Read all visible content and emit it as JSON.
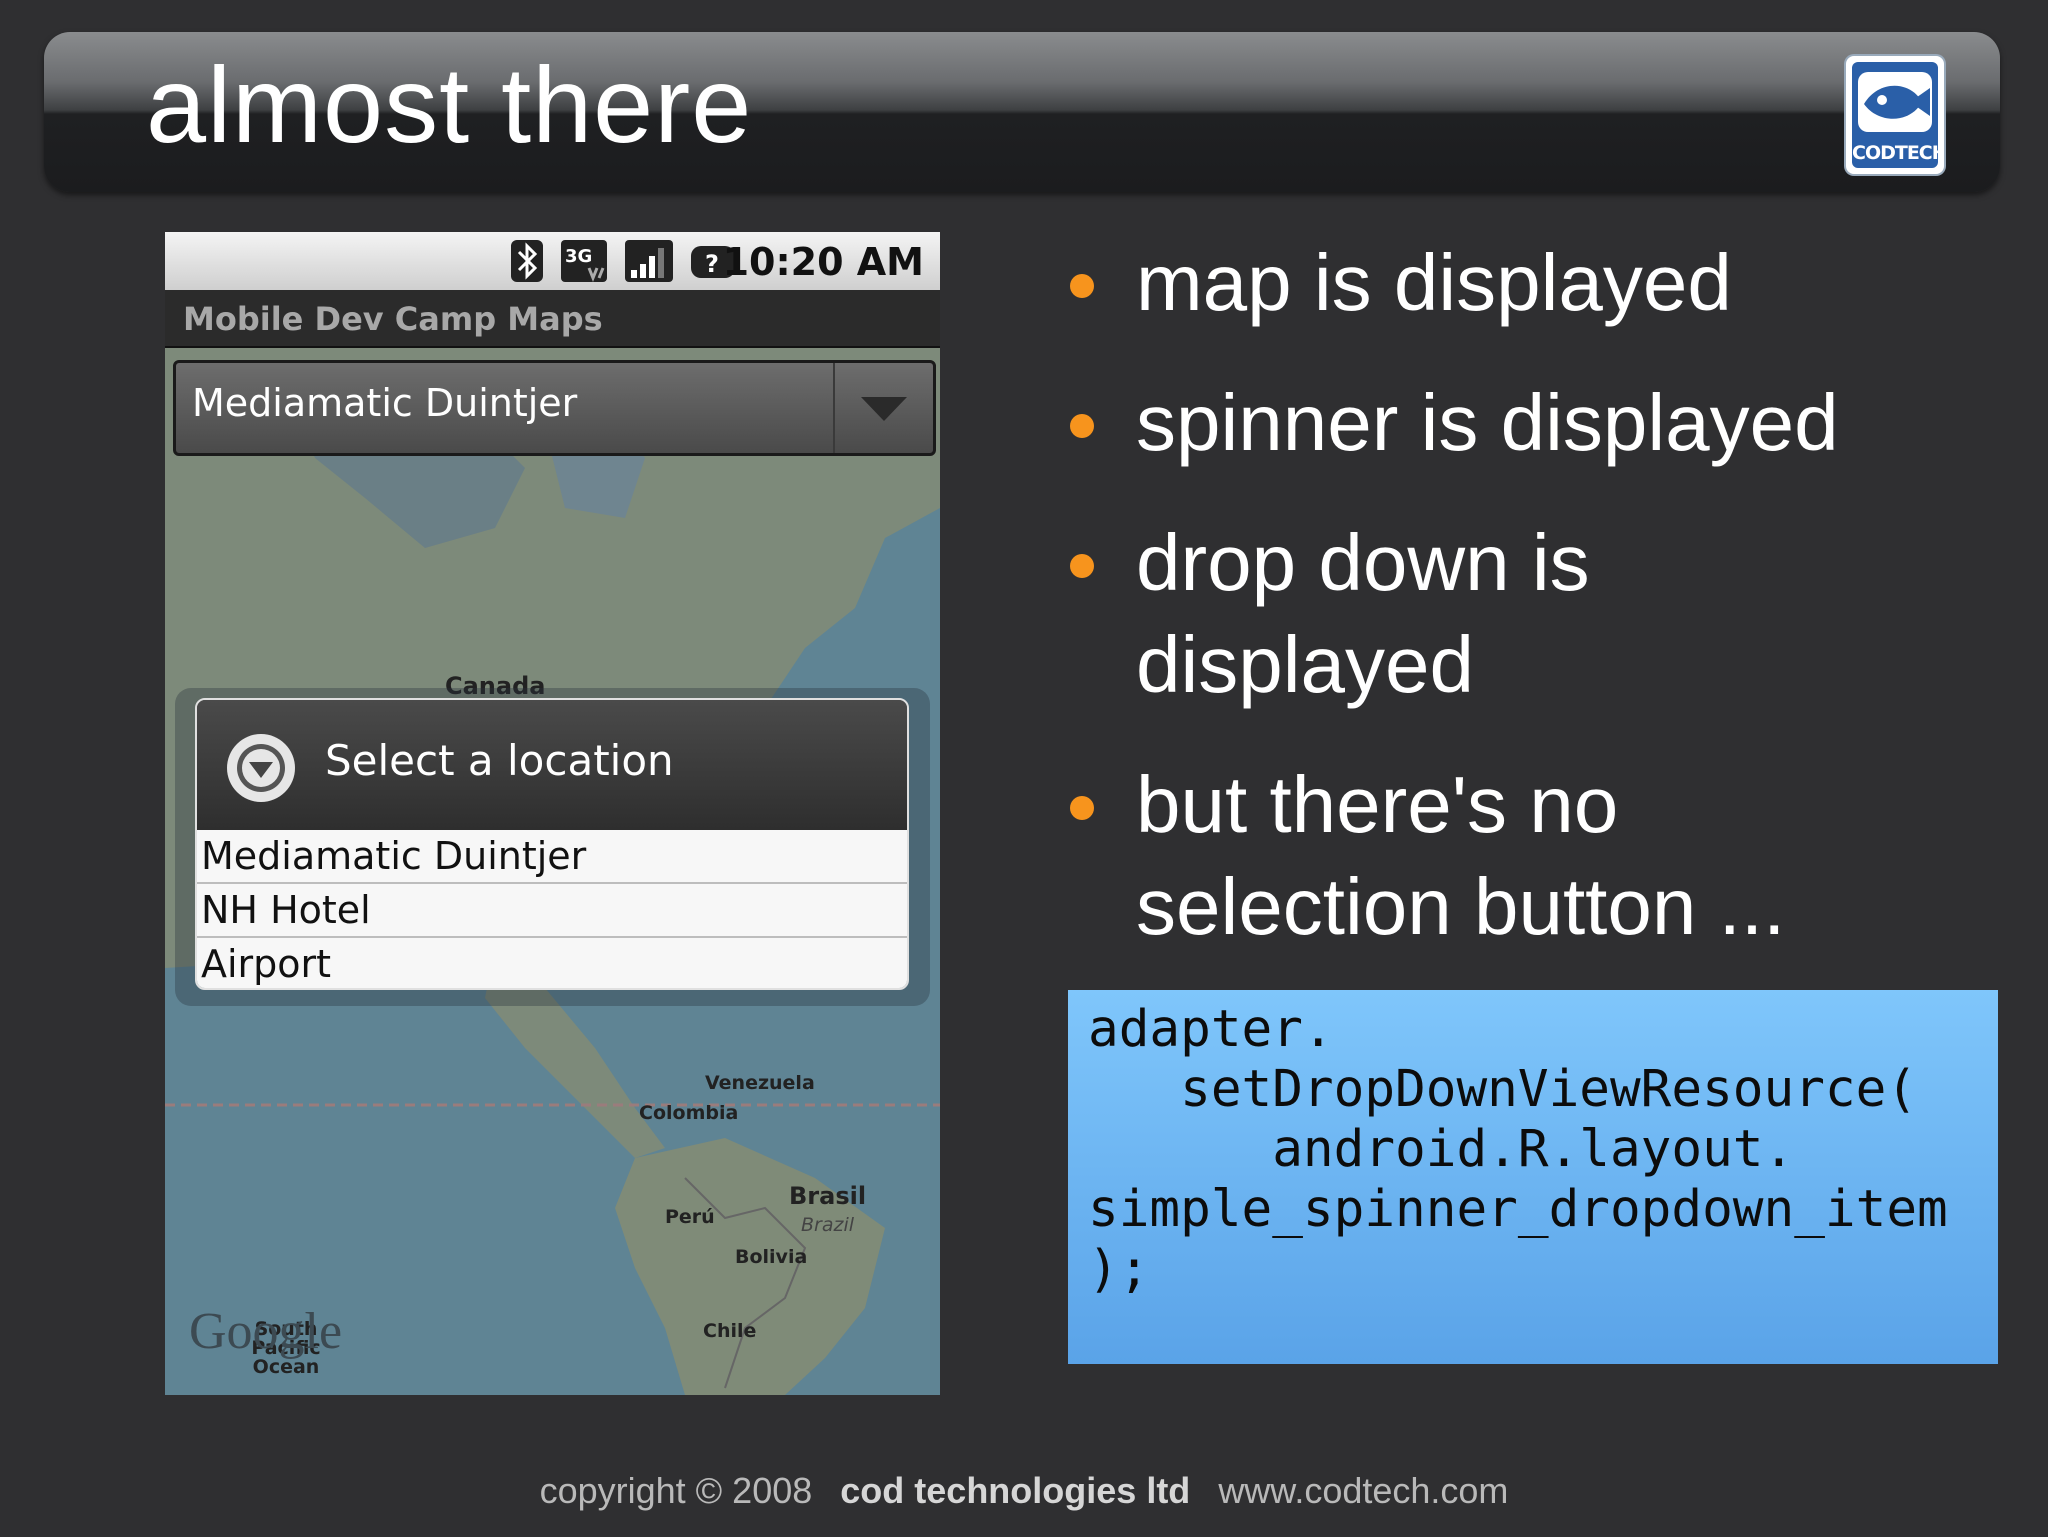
{
  "slide": {
    "title": "almost there",
    "logo_text": "CODTECH"
  },
  "phone": {
    "status_time": "10:20 AM",
    "app_title": "Mobile Dev Camp Maps",
    "spinner_value": "Mediamatic Duintjer",
    "dialog": {
      "title": "Select a location",
      "items": [
        "Mediamatic Duintjer",
        "NH Hotel",
        "Airport"
      ]
    },
    "map_labels": {
      "canada": "Canada",
      "venezuela": "Venezuela",
      "colombia": "Colombia",
      "brasil": "Brasil",
      "brazil": "Brazil",
      "peru": "Perú",
      "bolivia": "Bolivia",
      "chile": "Chile",
      "south_pacific": "South Pacific Ocean",
      "google": "Google"
    }
  },
  "bullets": [
    {
      "lines": [
        "map is displayed"
      ]
    },
    {
      "lines": [
        "spinner is displayed"
      ]
    },
    {
      "lines": [
        "drop down is",
        "displayed"
      ]
    },
    {
      "lines": [
        "but there's no",
        "selection button ..."
      ]
    }
  ],
  "code": {
    "lines": [
      "adapter.",
      "   setDropDownViewResource(",
      "      android.R.layout.",
      "simple_spinner_dropdown_item",
      ");"
    ]
  },
  "footer": {
    "copyright": "copyright © 2008",
    "company": "cod technologies ltd",
    "website": "www.codtech.com"
  },
  "colors": {
    "background": "#2f2f31",
    "bullet": "#f7941d",
    "code_box": "#6fb6f5"
  }
}
